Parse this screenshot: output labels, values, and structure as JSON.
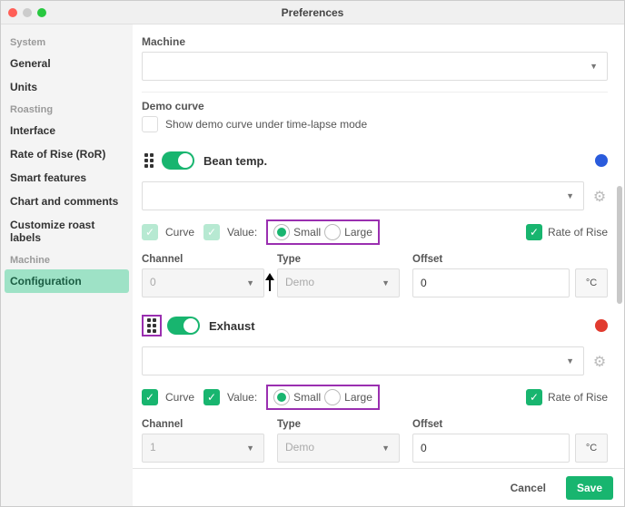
{
  "window": {
    "title": "Preferences"
  },
  "sidebar": {
    "groups": [
      {
        "head": "System",
        "items": [
          "General",
          "Units"
        ]
      },
      {
        "head": "Roasting",
        "items": [
          "Interface",
          "Rate of Rise (RoR)",
          "Smart features",
          "Chart and comments",
          "Customize roast labels"
        ]
      },
      {
        "head": "Machine",
        "items": [
          "Configuration"
        ]
      }
    ],
    "active": "Configuration"
  },
  "main": {
    "machine_label": "Machine",
    "demo": {
      "head": "Demo curve",
      "text": "Show demo curve under time-lapse mode"
    },
    "labels": {
      "curve": "Curve",
      "value": "Value:",
      "small": "Small",
      "large": "Large",
      "ror": "Rate of Rise",
      "channel": "Channel",
      "type": "Type",
      "offset": "Offset",
      "degc": "°C"
    },
    "cards": [
      {
        "title": "Bean temp.",
        "dot": "blue",
        "curve_chk": "light",
        "value_chk": "light",
        "grip_hl": false,
        "channel": "0",
        "type": "Demo",
        "offset": "0"
      },
      {
        "title": "Exhaust",
        "dot": "red",
        "curve_chk": "on",
        "value_chk": "on",
        "grip_hl": true,
        "channel": "1",
        "type": "Demo",
        "offset": "0"
      }
    ]
  },
  "footer": {
    "cancel": "Cancel",
    "save": "Save"
  }
}
